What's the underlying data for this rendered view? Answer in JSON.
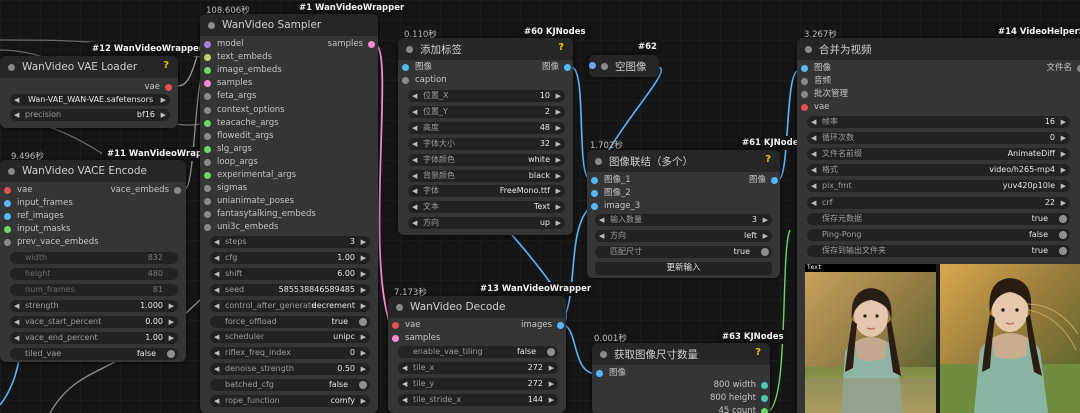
{
  "vae_loader": {
    "title": "WanVideo VAE Loader",
    "badge": "#12 WanVideoWrapper",
    "out_vae": "vae",
    "model_name": "Wan-VAE_WAN-VAE.safetensors",
    "precision_label": "precision",
    "precision": "bf16",
    "help_icon": "?"
  },
  "vace_encode": {
    "title": "WanVideo VACE Encode",
    "badge": "#11 WanVideoWrapper",
    "time": "9.496秒",
    "inputs": [
      "vae",
      "input_frames",
      "ref_images",
      "input_masks",
      "prev_vace_embeds"
    ],
    "out": "vace_embeds",
    "widgets": [
      {
        "label": "width",
        "value": "832",
        "dis": true
      },
      {
        "label": "height",
        "value": "480",
        "dis": true
      },
      {
        "label": "num_frames",
        "value": "81",
        "dis": true
      },
      {
        "label": "strength",
        "value": "1.000"
      },
      {
        "label": "vace_start_percent",
        "value": "0.00"
      },
      {
        "label": "vace_end_percent",
        "value": "1.00"
      },
      {
        "label": "tiled_vae",
        "value": "false"
      }
    ]
  },
  "sampler": {
    "title": "WanVideo Sampler",
    "badge": "#1 WanVideoWrapper",
    "time": "108.606秒",
    "out": "samples",
    "inputs": [
      "model",
      "text_embeds",
      "image_embeds",
      "samples",
      "feta_args",
      "context_options",
      "teacache_args",
      "flowedit_args",
      "slg_args",
      "loop_args",
      "experimental_args",
      "sigmas",
      "unianimate_poses",
      "fantasytalking_embeds",
      "uni3c_embeds"
    ],
    "widgets": [
      {
        "label": "steps",
        "value": "3"
      },
      {
        "label": "cfg",
        "value": "1.00"
      },
      {
        "label": "shift",
        "value": "6.00"
      },
      {
        "label": "seed",
        "value": "585538846589485"
      },
      {
        "label": "control_after_generate",
        "value": "decrement"
      },
      {
        "label": "force_offload",
        "value": "true"
      },
      {
        "label": "scheduler",
        "value": "unipc"
      },
      {
        "label": "riflex_freq_index",
        "value": "0"
      },
      {
        "label": "denoise_strength",
        "value": "0.50"
      },
      {
        "label": "batched_cfg",
        "value": "false"
      },
      {
        "label": "rope_function",
        "value": "comfy"
      }
    ]
  },
  "add_label": {
    "title": "添加标签",
    "badge": "#60 KJNodes",
    "time": "0.110秒",
    "in_image": "图像",
    "in_caption": "caption",
    "out": "图像",
    "help_icon": "?",
    "widgets": [
      {
        "label": "位置_X",
        "value": "10"
      },
      {
        "label": "位置_Y",
        "value": "2"
      },
      {
        "label": "高度",
        "value": "48"
      },
      {
        "label": "字体大小",
        "value": "32"
      },
      {
        "label": "字体颜色",
        "value": "white"
      },
      {
        "label": "背景颜色",
        "value": "black"
      },
      {
        "label": "字体",
        "value": "FreeMono.ttf"
      },
      {
        "label": "文本",
        "value": "Text"
      },
      {
        "label": "方向",
        "value": "up"
      }
    ]
  },
  "empty_image": {
    "title": "空图像",
    "badge": "#62"
  },
  "concat": {
    "title": "图像联结（多个）",
    "badge": "#61 KJNodes",
    "time": "1.702秒",
    "inputs": [
      "图像_1",
      "图像_2",
      "image_3"
    ],
    "out": "图像",
    "help_icon": "?",
    "widgets": [
      {
        "label": "输入数量",
        "value": "3"
      },
      {
        "label": "方向",
        "value": "left"
      },
      {
        "label": "匹配尺寸",
        "value": "true"
      }
    ],
    "button": "更新输入"
  },
  "decode": {
    "title": "WanVideo Decode",
    "badge": "#13 WanVideoWrapper",
    "time": "7.173秒",
    "inputs": [
      "vae",
      "samples"
    ],
    "out": "images",
    "widgets": [
      {
        "label": "enable_vae_tiling",
        "value": "false"
      },
      {
        "label": "tile_x",
        "value": "272"
      },
      {
        "label": "tile_y",
        "value": "272"
      },
      {
        "label": "tile_stride_x",
        "value": "144"
      }
    ]
  },
  "img_size": {
    "title": "获取图像尺寸数量",
    "badge": "#63 KJNodes",
    "time": "0.001秒",
    "in": "图像",
    "help_icon": "?",
    "outs": [
      "800 width",
      "800 height",
      "45 count"
    ]
  },
  "combine": {
    "title": "合并为视频",
    "badge": "#14 VideoHelperSuite",
    "time": "3.267秒",
    "inputs": [
      "图像",
      "音频",
      "批次管理",
      "vae"
    ],
    "out": "文件名",
    "widgets": [
      {
        "label": "帧率",
        "value": "16"
      },
      {
        "label": "循环次数",
        "value": "0"
      },
      {
        "label": "文件名前缀",
        "value": "AnimateDiff"
      },
      {
        "label": "格式",
        "value": "video/h265-mp4"
      },
      {
        "label": "pix_fmt",
        "value": "yuv420p10le"
      },
      {
        "label": "crf",
        "value": "22"
      },
      {
        "label": "保存元数据",
        "value": "true"
      },
      {
        "label": "Ping-Pong",
        "value": "false"
      },
      {
        "label": "保存到输出文件夹",
        "value": "true"
      }
    ],
    "preview_label": "Text"
  },
  "colors": {
    "canvas": "#151515",
    "node": "#353535",
    "header": "#262626",
    "widget": "#222222",
    "image_wire": "#57b7ff",
    "latent_wire": "#ff8ad8",
    "vae_wire": "#e55050",
    "help": "#f0c000"
  }
}
